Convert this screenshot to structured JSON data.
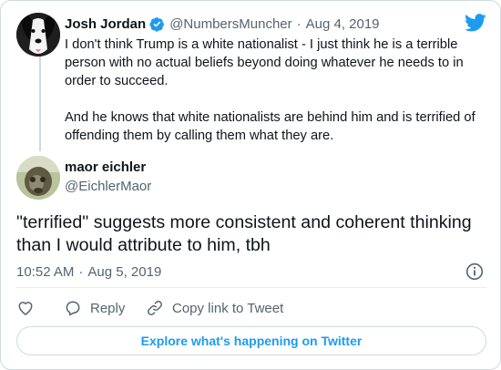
{
  "parent_tweet": {
    "author_name": "Josh Jordan",
    "handle": "@NumbersMuncher",
    "separator": "·",
    "date": "Aug 4, 2019",
    "paragraphs": [
      "I don't think Trump is a white nationalist - I just think he is a terrible person with no actual beliefs beyond doing whatever he needs to in order to succeed.",
      "And he knows that white nationalists are behind him and is terrified of offending them by calling them what they are."
    ]
  },
  "reply_tweet": {
    "author_name": "maor eichler",
    "handle": "@EichlerMaor",
    "text": "\"terrified\" suggests more consistent and coherent thinking than I would attribute to him, tbh",
    "time": "10:52 AM",
    "separator": "·",
    "date": "Aug 5, 2019"
  },
  "actions": {
    "reply_label": "Reply",
    "copy_link_label": "Copy link to Tweet"
  },
  "explore_button_label": "Explore what's happening on Twitter",
  "icons": {
    "brand": "twitter-bird-icon",
    "verified": "verified-badge-icon",
    "info": "info-icon",
    "like": "heart-icon",
    "reply": "speech-bubble-icon",
    "copy_link": "link-icon"
  },
  "colors": {
    "brand_blue": "#1d9bf0",
    "text_primary": "#0f1419",
    "text_secondary": "#536471",
    "border": "#cfd9de"
  }
}
